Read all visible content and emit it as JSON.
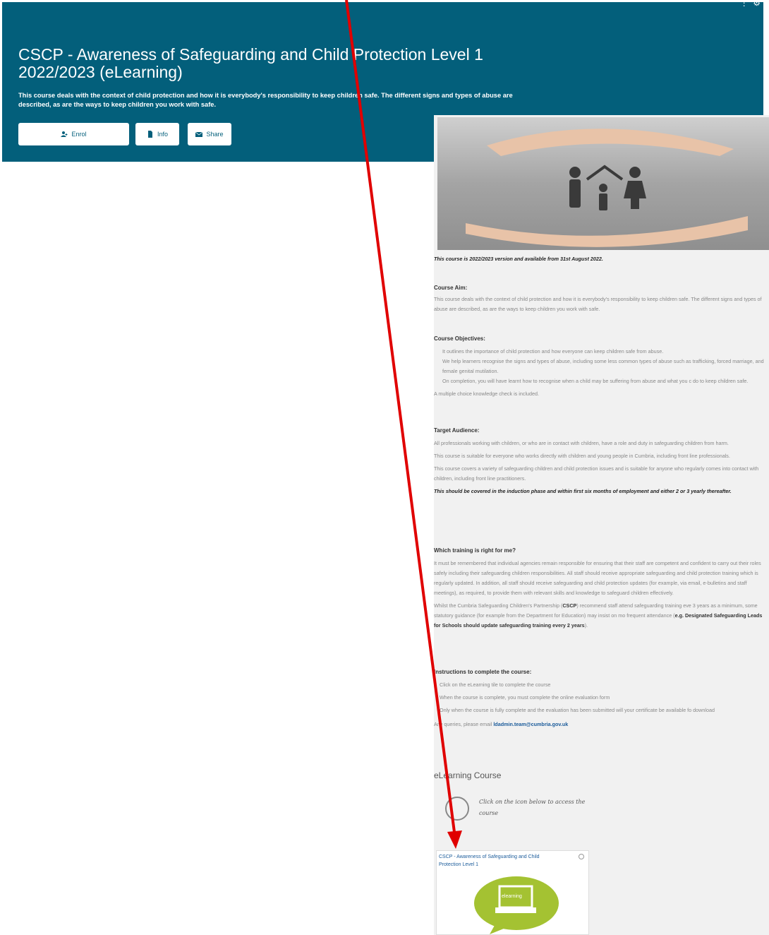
{
  "hero": {
    "title": "CSCP - Awareness of Safeguarding and Child Protection Level 1 2022/2023 (eLearning)",
    "description": "This course deals with the context of child protection and how it is everybody's responsibility to keep children safe. The different signs and types of abuse are described, as are the ways to keep children you work with safe.",
    "buttons": {
      "enrol": "Enrol",
      "info": "Info",
      "share": "Share"
    }
  },
  "panel": {
    "version_note": "This course is 2022/2023 version and available from 31st August 2022.",
    "aim": {
      "heading": "Course Aim:",
      "text": "This course deals with the context of child protection and how it is everybody's responsibility to keep children safe. The different signs and types of abuse are described, as are the ways to keep children you work with safe."
    },
    "objectives": {
      "heading": "Course Objectives:",
      "items": [
        "It outlines the importance of child protection and how everyone can keep children safe from abuse.",
        "We help learners recognise the signs and types of abuse, including some less common types of abuse such as trafficking, forced marriage, and female genital mutilation.",
        "On completion, you will have learnt how to recognise when a child may be suffering from abuse and what you c do to keep children safe."
      ],
      "note": "A multiple choice knowledge check is included."
    },
    "audience": {
      "heading": "Target Audience:",
      "p1": "All professionals working with children, or who are in contact with children, have a role and duty in safeguarding children from harm.",
      "p2": "This course is suitable for everyone who works directly with children and young people in Cumbria, including front line professionals.",
      "p3": "This course covers a variety of safeguarding children and child protection issues and is suitable for anyone who regularly comes into contact with children, including front line practitioners.",
      "p4": "This should be covered in the induction phase and within first six months of employment and either 2 or 3 yearly thereafter."
    },
    "training": {
      "heading": "Which training is right for me?",
      "p1": "It must be remembered that individual agencies remain responsible for ensuring that their staff are competent and confident to carry out their roles safely including their safeguarding children responsibilities.  All staff should receive appropriate safeguarding and child protection training which is regularly updated. In addition, all staff should receive safeguarding and child protection updates (for example, via email, e-bulletins and staff meetings), as required, to provide them with relevant skills and knowledge to safeguard children effectively.",
      "p2_start": "Whilst the Cumbria Safeguarding Children's Partnership (",
      "p2_acronym": "CSCP",
      "p2_mid": ") recommend staff attend safeguarding training eve 3 years as a minimum, some statutory guidance (for example from the Department for Education) may insist on mo frequent attendance (",
      "p2_bold": "e.g. Designated Safeguarding Leads for Schools should update safeguarding training every 2 years",
      "p2_end": ")."
    },
    "instructions": {
      "heading": "Instructions to complete the course:",
      "items": [
        "Click on the eLearning tile to complete the course",
        "When the course is complete, you must complete the online evaluation form",
        "Only when the course is fully complete and the evaluation has been submitted will your certificate be available fo download"
      ],
      "queries_prefix": "Any queries, please email ",
      "email": "ldadmin.team@cumbria.gov.uk"
    },
    "elearning": {
      "heading": "eLearning Course",
      "hint": "Click on the icon below to access the course",
      "tile_title": "CSCP - Awareness of Safeguarding and Child Protection Level 1",
      "tile_badge": "elearning"
    }
  },
  "colors": {
    "hero_bg": "#035f7b",
    "annotation_arrow": "#e00000",
    "tile_green": "#a4c232"
  }
}
